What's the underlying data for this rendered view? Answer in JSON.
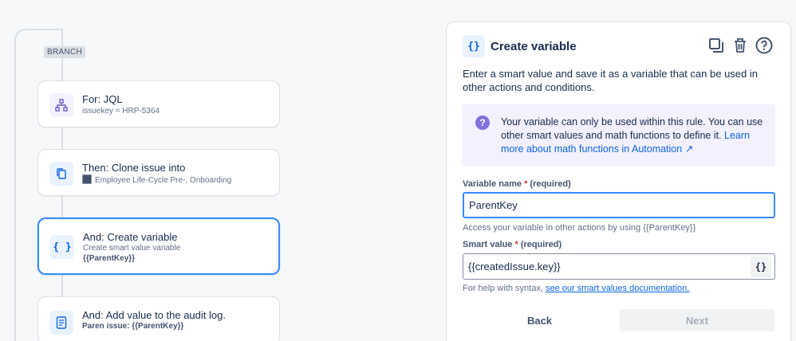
{
  "flow": {
    "branch_label": "BRANCH",
    "cards": [
      {
        "title": "For: JQL",
        "subtitle": "issuekey = HRP-5364",
        "icon": "hierarchy-icon"
      },
      {
        "title": "Then: Clone issue into",
        "subtitle": "Employee Life-Cycle Pre-, Onboarding",
        "icon": "copy-icon"
      },
      {
        "title": "And: Create variable",
        "subtitle": "Create smart value variable",
        "detail": "{{ParentKey}}",
        "icon": "braces-icon"
      },
      {
        "title": "And: Add value to the audit log.",
        "subtitle": "Paren issue: {{ParentKey}}",
        "icon": "document-icon"
      }
    ]
  },
  "panel": {
    "icon_text": "{}",
    "title": "Create variable",
    "description": "Enter a smart value and save it as a variable that can be used in other actions and conditions.",
    "info": {
      "text": "Your variable can only be used within this rule. You can use other smart values and math functions to define it.",
      "link": "Learn more about math functions in Automation ↗"
    },
    "variable_name": {
      "label": "Variable name",
      "required": "(required)",
      "value": "ParentKey",
      "help": "Access your variable in other actions by using {{ParentKey}}"
    },
    "smart_value": {
      "label": "Smart value",
      "required": "(required)",
      "value": "{{createdIssue.key}}",
      "brace": "{}",
      "help_prefix": "For help with syntax, ",
      "help_link": "see our smart values documentation."
    },
    "back_label": "Back",
    "next_label": "Next"
  },
  "colors": {
    "accent": "#388bff",
    "info_bg": "#f3f0ff",
    "link": "#0c66e4"
  }
}
